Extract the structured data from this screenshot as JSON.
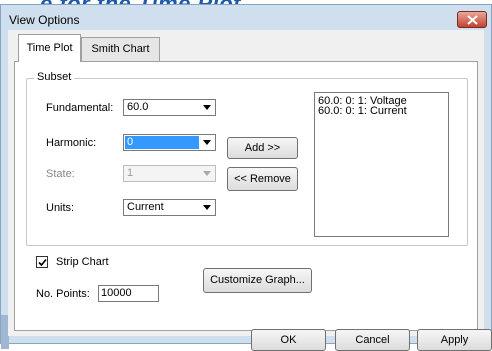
{
  "background_heading": "e for the Time Plot",
  "window": {
    "title": "View Options"
  },
  "tabs": [
    {
      "label": "Time Plot",
      "active": true
    },
    {
      "label": "Smith Chart",
      "active": false
    }
  ],
  "subset": {
    "group_label": "Subset",
    "fundamental": {
      "label": "Fundamental:",
      "value": "60.0"
    },
    "harmonic": {
      "label": "Harmonic:",
      "value": "0"
    },
    "state": {
      "label": "State:",
      "value": "1",
      "disabled": true
    },
    "units": {
      "label": "Units:",
      "value": "Current"
    },
    "add_button": "Add >>",
    "remove_button": "<< Remove",
    "list_items": [
      "60.0: 0: 1: Voltage",
      "60.0: 0: 1: Current"
    ]
  },
  "strip_chart": {
    "label": "Strip Chart",
    "checked": true
  },
  "points": {
    "label": "No. Points:",
    "value": "10000"
  },
  "customize_button": "Customize Graph...",
  "footer": {
    "ok": "OK",
    "cancel": "Cancel",
    "apply": "Apply"
  },
  "colors": {
    "title_bar": "#cfdfee",
    "close_button": "#c2422e",
    "selection": "#3399ff",
    "heading": "#1e5aa8"
  }
}
